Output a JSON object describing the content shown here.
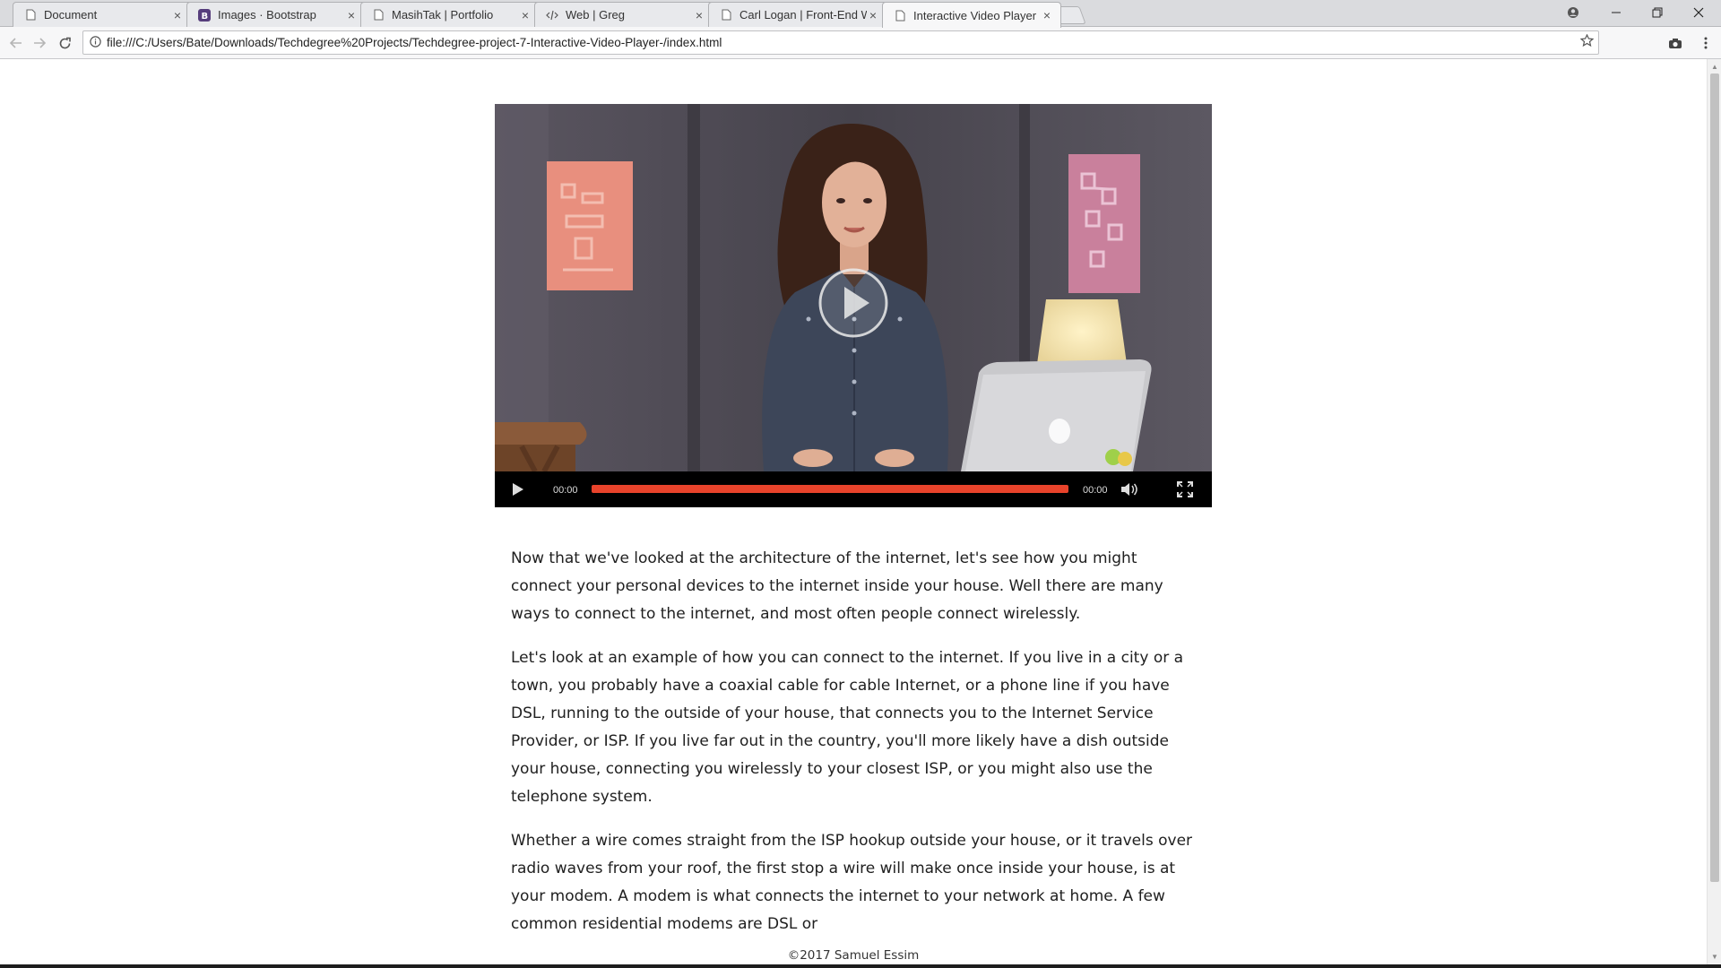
{
  "browser": {
    "tabs": [
      {
        "title": "Document",
        "icon": "page-icon",
        "active": false
      },
      {
        "title": "Images · Bootstrap",
        "icon": "bootstrap-icon",
        "active": false
      },
      {
        "title": "MasihTak | Portfolio",
        "icon": "page-icon",
        "active": false
      },
      {
        "title": "Web | Greg",
        "icon": "code-icon",
        "active": false
      },
      {
        "title": "Carl Logan | Front-End W",
        "icon": "page-icon",
        "active": false
      },
      {
        "title": "Interactive Video Player",
        "icon": "page-icon",
        "active": true
      }
    ],
    "tab_close": "×",
    "url": "file:///C:/Users/Bate/Downloads/Techdegree%20Projects/Techdegree-project-7-Interactive-Video-Player-/index.html"
  },
  "video": {
    "current_time": "00:00",
    "duration": "00:00",
    "progress": 1.0,
    "accent_color": "#e8432b"
  },
  "transcript": {
    "paragraphs": [
      "Now that we've looked at the architecture of the internet, let's see how you might connect your personal devices to the internet inside your house. Well there are many ways to connect to the internet, and most often people connect wirelessly.",
      "Let's look at an example of how you can connect to the internet. If you live in a city or a town, you probably have a coaxial cable for cable Internet, or a phone line if you have DSL, running to the outside of your house, that connects you to the Internet Service Provider, or ISP. If you live far out in the country, you'll more likely have a dish outside your house, connecting you wirelessly to your closest ISP, or you might also use the telephone system.",
      "Whether a wire comes straight from the ISP hookup outside your house, or it travels over radio waves from your roof, the first stop a wire will make once inside your house, is at your modem. A modem is what connects the internet to your network at home. A few common residential modems are DSL or"
    ]
  },
  "footer": {
    "text": "©2017 Samuel Essim"
  }
}
